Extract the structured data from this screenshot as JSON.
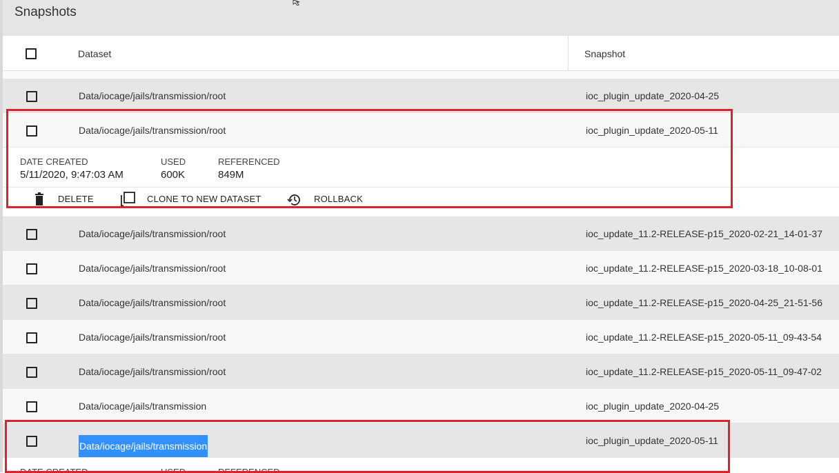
{
  "page": {
    "title": "Snapshots"
  },
  "table": {
    "columns": {
      "dataset": "Dataset",
      "snapshot": "Snapshot"
    },
    "rows": [
      {
        "dataset": "Data/iocage/jails/transmission/root",
        "snapshot": "ioc_plugin_update_2020-04-25"
      },
      {
        "dataset": "Data/iocage/jails/transmission/root",
        "snapshot": "ioc_plugin_update_2020-05-11"
      },
      {
        "dataset": "Data/iocage/jails/transmission/root",
        "snapshot": "ioc_update_11.2-RELEASE-p15_2020-02-21_14-01-37"
      },
      {
        "dataset": "Data/iocage/jails/transmission/root",
        "snapshot": "ioc_update_11.2-RELEASE-p15_2020-03-18_10-08-01"
      },
      {
        "dataset": "Data/iocage/jails/transmission/root",
        "snapshot": "ioc_update_11.2-RELEASE-p15_2020-04-25_21-51-56"
      },
      {
        "dataset": "Data/iocage/jails/transmission/root",
        "snapshot": "ioc_update_11.2-RELEASE-p15_2020-05-11_09-43-54"
      },
      {
        "dataset": "Data/iocage/jails/transmission/root",
        "snapshot": "ioc_update_11.2-RELEASE-p15_2020-05-11_09-47-02"
      },
      {
        "dataset": "Data/iocage/jails/transmission",
        "snapshot": "ioc_plugin_update_2020-04-25"
      },
      {
        "dataset": "Data/iocage/jails/transmission",
        "snapshot": "ioc_plugin_update_2020-05-11"
      }
    ]
  },
  "details": {
    "date_created_label": "DATE CREATED",
    "date_created_value": "5/11/2020, 9:47:03 AM",
    "used_label": "USED",
    "used_value": "600K",
    "referenced_label": "REFERENCED",
    "referenced_value": "849M"
  },
  "details_partial": {
    "date_created_label": "DATE CREATED",
    "used_label": "USED",
    "referenced_label": "REFERENCED"
  },
  "actions": {
    "delete": "DELETE",
    "clone": "CLONE TO NEW DATASET",
    "rollback": "ROLLBACK"
  },
  "icons": {
    "delete": "trash-icon",
    "clone": "clone-icon",
    "rollback": "history-icon"
  },
  "colors": {
    "highlight": "#e0202a",
    "selection": "#3390ff"
  }
}
